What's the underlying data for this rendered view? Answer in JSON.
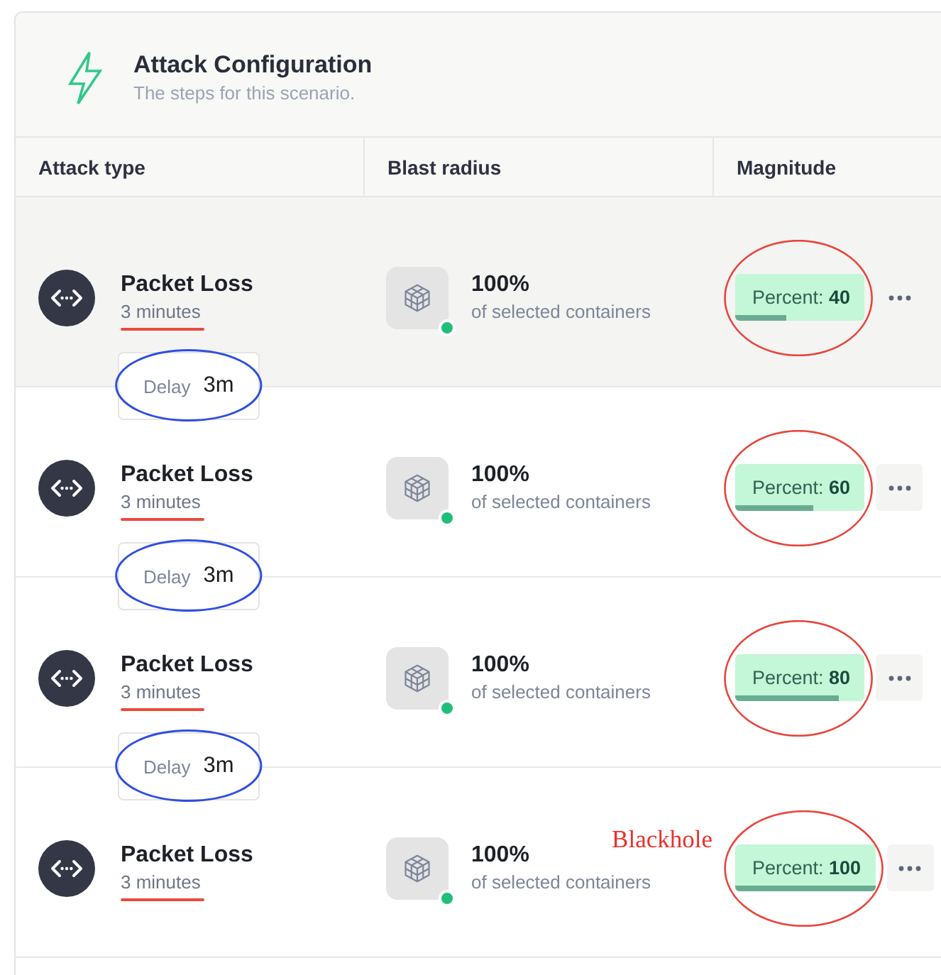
{
  "card": {
    "title": "Attack Configuration",
    "subtitle": "The steps for this scenario."
  },
  "table": {
    "columns": [
      "Attack type",
      "Blast radius",
      "Magnitude"
    ],
    "items": [
      {
        "kind": "step",
        "highlighted": true,
        "name": "Packet Loss",
        "duration": {
          "text": "3 minutes",
          "underlined": true
        },
        "blast": {
          "value": "100%",
          "caption": "of selected containers"
        },
        "magnitude": {
          "text": "Percent: **40**",
          "level": 0.4,
          "circled": true
        }
      },
      {
        "kind": "delay",
        "label": "Delay",
        "value": "3m",
        "circled": true
      },
      {
        "kind": "step",
        "highlighted": false,
        "name": "Packet Loss",
        "duration": {
          "text": "3 minutes",
          "underlined": true
        },
        "blast": {
          "value": "100%",
          "caption": "of selected containers"
        },
        "magnitude": {
          "text": "Percent: **60**",
          "level": 0.6,
          "circled": true
        }
      },
      {
        "kind": "delay",
        "label": "Delay",
        "value": "3m",
        "circled": true
      },
      {
        "kind": "step",
        "highlighted": false,
        "name": "Packet Loss",
        "duration": {
          "text": "3 minutes",
          "underlined": true
        },
        "blast": {
          "value": "100%",
          "caption": "of selected containers"
        },
        "magnitude": {
          "text": "Percent: **80**",
          "level": 0.8,
          "circled": true
        }
      },
      {
        "kind": "delay",
        "label": "Delay",
        "value": "3m",
        "circled": true
      },
      {
        "kind": "step",
        "highlighted": false,
        "name": "Packet Loss",
        "duration": {
          "text": "3 minutes",
          "underlined": true
        },
        "blast": {
          "value": "100%",
          "caption": "of selected containers"
        },
        "magnitude": {
          "text": "Percent: **100**",
          "level": 1,
          "circled": true
        },
        "note": "Blackhole"
      }
    ]
  }
}
